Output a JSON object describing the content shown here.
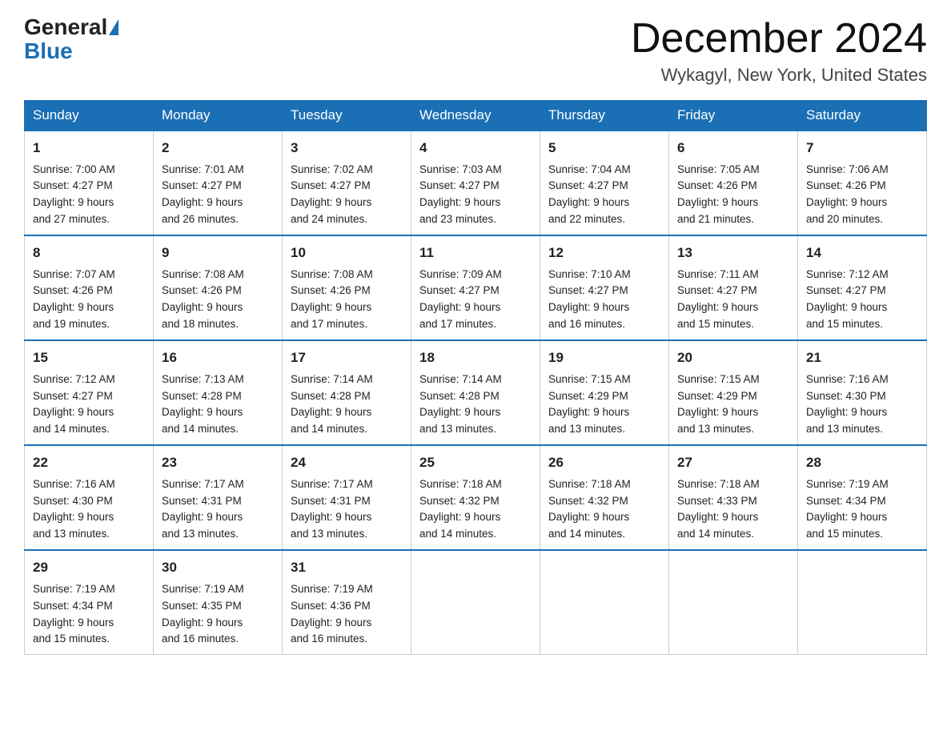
{
  "header": {
    "logo_general": "General",
    "logo_blue": "Blue",
    "month_title": "December 2024",
    "location": "Wykagyl, New York, United States"
  },
  "days_of_week": [
    "Sunday",
    "Monday",
    "Tuesday",
    "Wednesday",
    "Thursday",
    "Friday",
    "Saturday"
  ],
  "weeks": [
    [
      {
        "day": "1",
        "sunrise": "7:00 AM",
        "sunset": "4:27 PM",
        "daylight": "9 hours and 27 minutes."
      },
      {
        "day": "2",
        "sunrise": "7:01 AM",
        "sunset": "4:27 PM",
        "daylight": "9 hours and 26 minutes."
      },
      {
        "day": "3",
        "sunrise": "7:02 AM",
        "sunset": "4:27 PM",
        "daylight": "9 hours and 24 minutes."
      },
      {
        "day": "4",
        "sunrise": "7:03 AM",
        "sunset": "4:27 PM",
        "daylight": "9 hours and 23 minutes."
      },
      {
        "day": "5",
        "sunrise": "7:04 AM",
        "sunset": "4:27 PM",
        "daylight": "9 hours and 22 minutes."
      },
      {
        "day": "6",
        "sunrise": "7:05 AM",
        "sunset": "4:26 PM",
        "daylight": "9 hours and 21 minutes."
      },
      {
        "day": "7",
        "sunrise": "7:06 AM",
        "sunset": "4:26 PM",
        "daylight": "9 hours and 20 minutes."
      }
    ],
    [
      {
        "day": "8",
        "sunrise": "7:07 AM",
        "sunset": "4:26 PM",
        "daylight": "9 hours and 19 minutes."
      },
      {
        "day": "9",
        "sunrise": "7:08 AM",
        "sunset": "4:26 PM",
        "daylight": "9 hours and 18 minutes."
      },
      {
        "day": "10",
        "sunrise": "7:08 AM",
        "sunset": "4:26 PM",
        "daylight": "9 hours and 17 minutes."
      },
      {
        "day": "11",
        "sunrise": "7:09 AM",
        "sunset": "4:27 PM",
        "daylight": "9 hours and 17 minutes."
      },
      {
        "day": "12",
        "sunrise": "7:10 AM",
        "sunset": "4:27 PM",
        "daylight": "9 hours and 16 minutes."
      },
      {
        "day": "13",
        "sunrise": "7:11 AM",
        "sunset": "4:27 PM",
        "daylight": "9 hours and 15 minutes."
      },
      {
        "day": "14",
        "sunrise": "7:12 AM",
        "sunset": "4:27 PM",
        "daylight": "9 hours and 15 minutes."
      }
    ],
    [
      {
        "day": "15",
        "sunrise": "7:12 AM",
        "sunset": "4:27 PM",
        "daylight": "9 hours and 14 minutes."
      },
      {
        "day": "16",
        "sunrise": "7:13 AM",
        "sunset": "4:28 PM",
        "daylight": "9 hours and 14 minutes."
      },
      {
        "day": "17",
        "sunrise": "7:14 AM",
        "sunset": "4:28 PM",
        "daylight": "9 hours and 14 minutes."
      },
      {
        "day": "18",
        "sunrise": "7:14 AM",
        "sunset": "4:28 PM",
        "daylight": "9 hours and 13 minutes."
      },
      {
        "day": "19",
        "sunrise": "7:15 AM",
        "sunset": "4:29 PM",
        "daylight": "9 hours and 13 minutes."
      },
      {
        "day": "20",
        "sunrise": "7:15 AM",
        "sunset": "4:29 PM",
        "daylight": "9 hours and 13 minutes."
      },
      {
        "day": "21",
        "sunrise": "7:16 AM",
        "sunset": "4:30 PM",
        "daylight": "9 hours and 13 minutes."
      }
    ],
    [
      {
        "day": "22",
        "sunrise": "7:16 AM",
        "sunset": "4:30 PM",
        "daylight": "9 hours and 13 minutes."
      },
      {
        "day": "23",
        "sunrise": "7:17 AM",
        "sunset": "4:31 PM",
        "daylight": "9 hours and 13 minutes."
      },
      {
        "day": "24",
        "sunrise": "7:17 AM",
        "sunset": "4:31 PM",
        "daylight": "9 hours and 13 minutes."
      },
      {
        "day": "25",
        "sunrise": "7:18 AM",
        "sunset": "4:32 PM",
        "daylight": "9 hours and 14 minutes."
      },
      {
        "day": "26",
        "sunrise": "7:18 AM",
        "sunset": "4:32 PM",
        "daylight": "9 hours and 14 minutes."
      },
      {
        "day": "27",
        "sunrise": "7:18 AM",
        "sunset": "4:33 PM",
        "daylight": "9 hours and 14 minutes."
      },
      {
        "day": "28",
        "sunrise": "7:19 AM",
        "sunset": "4:34 PM",
        "daylight": "9 hours and 15 minutes."
      }
    ],
    [
      {
        "day": "29",
        "sunrise": "7:19 AM",
        "sunset": "4:34 PM",
        "daylight": "9 hours and 15 minutes."
      },
      {
        "day": "30",
        "sunrise": "7:19 AM",
        "sunset": "4:35 PM",
        "daylight": "9 hours and 16 minutes."
      },
      {
        "day": "31",
        "sunrise": "7:19 AM",
        "sunset": "4:36 PM",
        "daylight": "9 hours and 16 minutes."
      },
      null,
      null,
      null,
      null
    ]
  ],
  "labels": {
    "sunrise": "Sunrise:",
    "sunset": "Sunset:",
    "daylight": "Daylight:"
  }
}
